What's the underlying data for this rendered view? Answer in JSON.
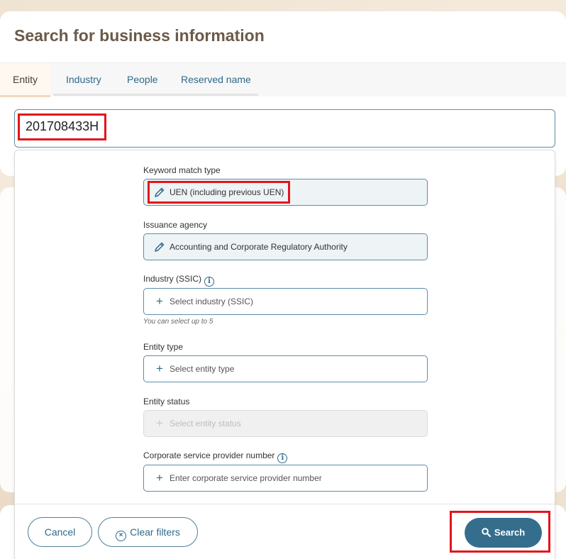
{
  "page": {
    "title": "Search for business information"
  },
  "tabs": [
    {
      "label": "Entity",
      "active": true
    },
    {
      "label": "Industry",
      "active": false
    },
    {
      "label": "People",
      "active": false
    },
    {
      "label": "Reserved name",
      "active": false
    }
  ],
  "search": {
    "value": "201708433H"
  },
  "filters": {
    "keyword_match": {
      "label": "Keyword match type",
      "value": "UEN (including previous UEN)",
      "icon": "pencil-icon"
    },
    "issuance_agency": {
      "label": "Issuance agency",
      "value": "Accounting and Corporate Regulatory Authority",
      "icon": "pencil-icon"
    },
    "industry": {
      "label": "Industry (SSIC)",
      "placeholder": "Select industry (SSIC)",
      "hint": "You can select up to 5",
      "icon": "plus-icon"
    },
    "entity_type": {
      "label": "Entity type",
      "placeholder": "Select entity type",
      "icon": "plus-icon"
    },
    "entity_status": {
      "label": "Entity status",
      "placeholder": "Select entity status",
      "icon": "plus-icon",
      "disabled": true
    },
    "csp_number": {
      "label": "Corporate service provider number",
      "placeholder": "Enter corporate service provider number",
      "icon": "plus-icon"
    }
  },
  "footer": {
    "cancel_label": "Cancel",
    "clear_label": "Clear filters",
    "search_label": "Search"
  },
  "colors": {
    "primary": "#356e8d",
    "highlight": "#e3141c",
    "title": "#6b5a4a"
  }
}
